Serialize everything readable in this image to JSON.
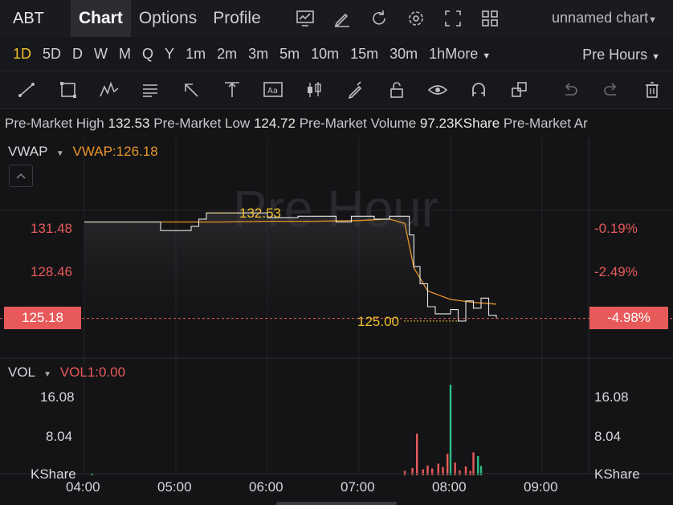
{
  "topbar": {
    "ticker": "ABT",
    "tabs": [
      "Chart",
      "Options",
      "Profile"
    ],
    "active_tab": 0,
    "chart_name": "unnamed chart"
  },
  "intervals": {
    "items": [
      "1D",
      "5D",
      "D",
      "W",
      "M",
      "Q",
      "Y",
      "1m",
      "2m",
      "3m",
      "5m",
      "10m",
      "15m",
      "30m",
      "1h"
    ],
    "active": 0,
    "more_label": "More",
    "session_label": "Pre Hours"
  },
  "info_bar": {
    "high_label": "Pre-Market High",
    "high_value": "132.53",
    "low_label": "Pre-Market Low",
    "low_value": "124.72",
    "volume_label": "Pre-Market Volume",
    "volume_value": "97.23KShare",
    "trailing_label": "Pre-Market Ar"
  },
  "price_panel": {
    "indicator": "VWAP",
    "indicator_value": "VWAP:126.18",
    "watermark": "Pre Hour",
    "high_marker": "132.53",
    "low_marker": "125.00",
    "left_ticks": [
      "131.48",
      "128.46"
    ],
    "current_price": "125.18",
    "right_ticks": [
      "-0.19%",
      "-2.49%"
    ],
    "current_change": "-4.98%"
  },
  "volume_panel": {
    "indicator": "VOL",
    "indicator_value": "VOL1:0.00",
    "ticks": [
      "16.08",
      "8.04"
    ],
    "unit": "KShare"
  },
  "time_axis": [
    "04:00",
    "05:00",
    "06:00",
    "07:00",
    "08:00",
    "09:00"
  ],
  "colors": {
    "accent": "#f0c02f",
    "down": "#e85a5a",
    "up": "#2dbd85",
    "vwap": "#e8952a",
    "price": "#e6e6e6"
  },
  "chart_data": {
    "type": "line",
    "x_range": [
      "04:00",
      "09:00"
    ],
    "series": [
      {
        "name": "VWAP",
        "x": [
          "04:00",
          "04:30",
          "05:00",
          "05:30",
          "06:00",
          "06:30",
          "07:00",
          "07:20",
          "07:30",
          "07:36",
          "07:45",
          "08:00",
          "08:15",
          "08:30"
        ],
        "values": [
          131.9,
          131.9,
          131.9,
          131.9,
          131.95,
          131.95,
          132.0,
          132.1,
          131.8,
          128.7,
          127.1,
          126.5,
          126.3,
          126.18
        ]
      },
      {
        "name": "Price",
        "x": [
          "04:00",
          "04:40",
          "04:50",
          "05:00",
          "05:10",
          "05:15",
          "05:20",
          "05:50",
          "06:00",
          "06:20",
          "06:45",
          "06:55",
          "07:00",
          "07:10",
          "07:20",
          "07:30",
          "07:33",
          "07:36",
          "07:40",
          "07:45",
          "07:50",
          "08:00",
          "08:05",
          "08:10",
          "08:15",
          "08:20",
          "08:25",
          "08:30"
        ],
        "values": [
          131.9,
          131.9,
          131.3,
          131.3,
          131.6,
          132.1,
          132.53,
          132.53,
          132.2,
          132.3,
          131.9,
          132.3,
          132.3,
          132.1,
          132.3,
          132.3,
          131.0,
          128.8,
          127.6,
          126.0,
          125.5,
          125.8,
          125.0,
          126.4,
          125.9,
          126.6,
          125.4,
          125.18
        ]
      }
    ],
    "volume": {
      "x": [
        "04:05",
        "07:30",
        "07:35",
        "07:38",
        "07:42",
        "07:45",
        "07:48",
        "07:52",
        "07:55",
        "07:58",
        "08:00",
        "08:03",
        "08:06",
        "08:10",
        "08:13",
        "08:15",
        "08:18",
        "08:20"
      ],
      "values": [
        0.3,
        0.9,
        1.5,
        8.5,
        1.2,
        2.0,
        1.4,
        2.4,
        1.7,
        4.4,
        18.5,
        2.6,
        1.0,
        1.8,
        0.9,
        4.7,
        3.9,
        1.9
      ]
    }
  }
}
